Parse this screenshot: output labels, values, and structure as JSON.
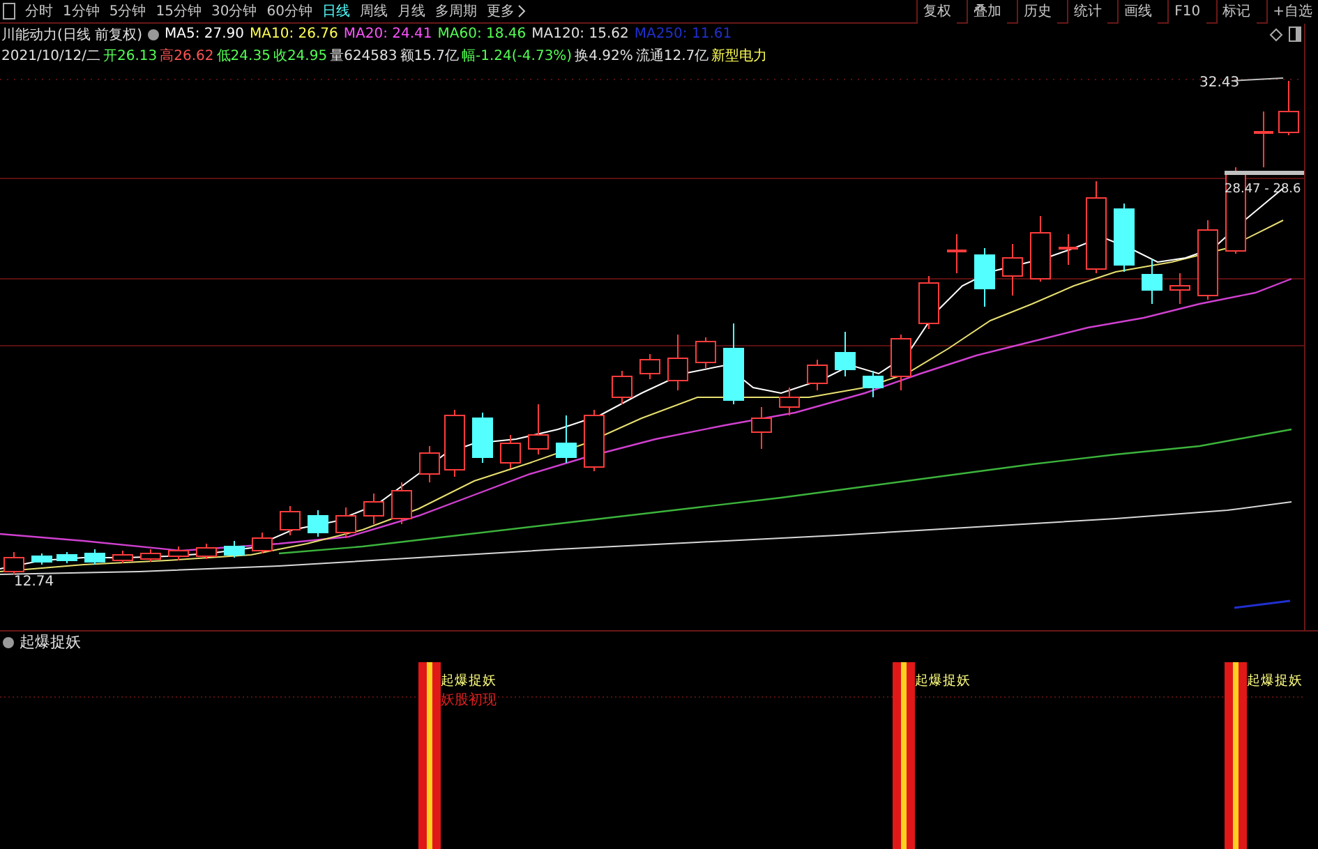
{
  "toolbar": {
    "periods": [
      {
        "label": "分时",
        "selected": false
      },
      {
        "label": "1分钟",
        "selected": false
      },
      {
        "label": "5分钟",
        "selected": false
      },
      {
        "label": "15分钟",
        "selected": false
      },
      {
        "label": "30分钟",
        "selected": false
      },
      {
        "label": "60分钟",
        "selected": false
      },
      {
        "label": "日线",
        "selected": true
      },
      {
        "label": "周线",
        "selected": false
      },
      {
        "label": "月线",
        "selected": false
      },
      {
        "label": "多周期",
        "selected": false
      },
      {
        "label": "更多",
        "selected": false
      }
    ],
    "buttons": [
      "复权",
      "叠加",
      "历史",
      "统计",
      "画线",
      "F10",
      "标记",
      "+自选"
    ]
  },
  "info": {
    "title": "川能动力(日线 前复权)",
    "ma": [
      {
        "label": "MA5: 27.90",
        "color": "#ffffff"
      },
      {
        "label": "MA10: 26.76",
        "color": "#ffff54"
      },
      {
        "label": "MA20: 24.41",
        "color": "#ff54ff"
      },
      {
        "label": "MA60: 18.46",
        "color": "#54ff54"
      },
      {
        "label": "MA120: 15.62",
        "color": "#e0e0e0"
      },
      {
        "label": "MA250: 11.61",
        "color": "#2030d0"
      }
    ],
    "quote": [
      {
        "text": "2021/10/12/二",
        "color": "#e0e0e0"
      },
      {
        "text": "开26.13",
        "color": "#54ff54"
      },
      {
        "text": "高26.62",
        "color": "#ff5454"
      },
      {
        "text": "低24.35",
        "color": "#54ff54"
      },
      {
        "text": "收24.95",
        "color": "#54ff54"
      },
      {
        "text": "量624583",
        "color": "#e0e0e0"
      },
      {
        "text": "额15.7亿",
        "color": "#e0e0e0"
      },
      {
        "text": "幅-1.24(-4.73%)",
        "color": "#54ff54"
      },
      {
        "text": "换4.92%",
        "color": "#e0e0e0"
      },
      {
        "text": "流通12.7亿",
        "color": "#e0e0e0"
      },
      {
        "text": "新型电力",
        "color": "#ffff54"
      }
    ]
  },
  "chart": {
    "high_label": "32.43",
    "last_label": "28.47 - 28.6",
    "low_label": "12.74"
  },
  "indicator": {
    "title": "起爆捉妖",
    "signals": [
      {
        "label": "起爆捉妖",
        "note": "妖股初现"
      },
      {
        "label": "起爆捉妖"
      },
      {
        "label": "起爆捉妖"
      }
    ]
  }
}
